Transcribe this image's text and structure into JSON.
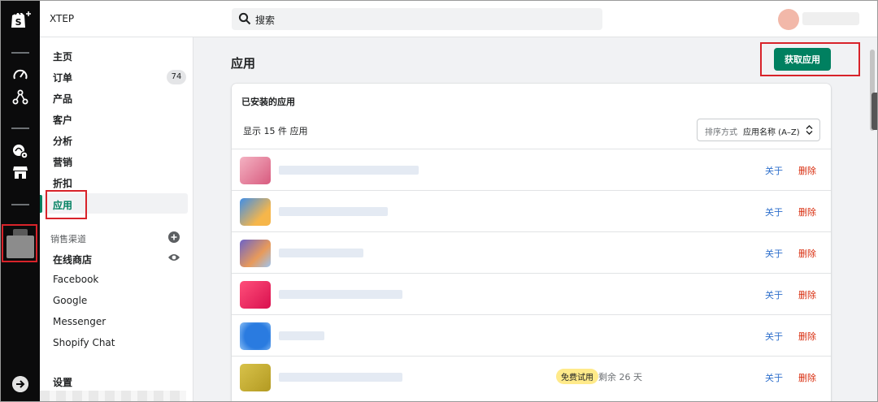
{
  "header": {
    "store_name": "XTEP",
    "search_placeholder": "搜索"
  },
  "sidebar": {
    "items": [
      {
        "label": "主页"
      },
      {
        "label": "订单",
        "count": "74"
      },
      {
        "label": "产品"
      },
      {
        "label": "客户"
      },
      {
        "label": "分析"
      },
      {
        "label": "营销"
      },
      {
        "label": "折扣"
      },
      {
        "label": "应用",
        "active": true
      }
    ],
    "sales_channels_label": "销售渠道",
    "channels": [
      "在线商店",
      "Facebook",
      "Google",
      "Messenger",
      "Shopify Chat"
    ],
    "settings_label": "设置"
  },
  "main": {
    "title": "应用",
    "get_apps_label": "获取应用",
    "card": {
      "title": "已安装的应用",
      "count_text": "显示 15 件 应用",
      "sort_label": "排序方式",
      "sort_value": "应用名称 (A–Z)",
      "about_label": "关于",
      "delete_label": "删除",
      "trial_badge": "免费试用",
      "trial_remaining": "剩余 26 天"
    }
  },
  "colors": {
    "accent": "#008060",
    "link": "#2c6ecb",
    "danger": "#d82c0d",
    "rail": "#0b0b0c",
    "highlight": "#d8232a"
  },
  "icons": [
    "shopify-logo-icon",
    "speedometer-icon",
    "graph-icon",
    "settings-store-icon",
    "store-icon",
    "search-icon",
    "plus-circle-icon",
    "eye-icon",
    "sort-arrows-icon",
    "exit-icon"
  ]
}
